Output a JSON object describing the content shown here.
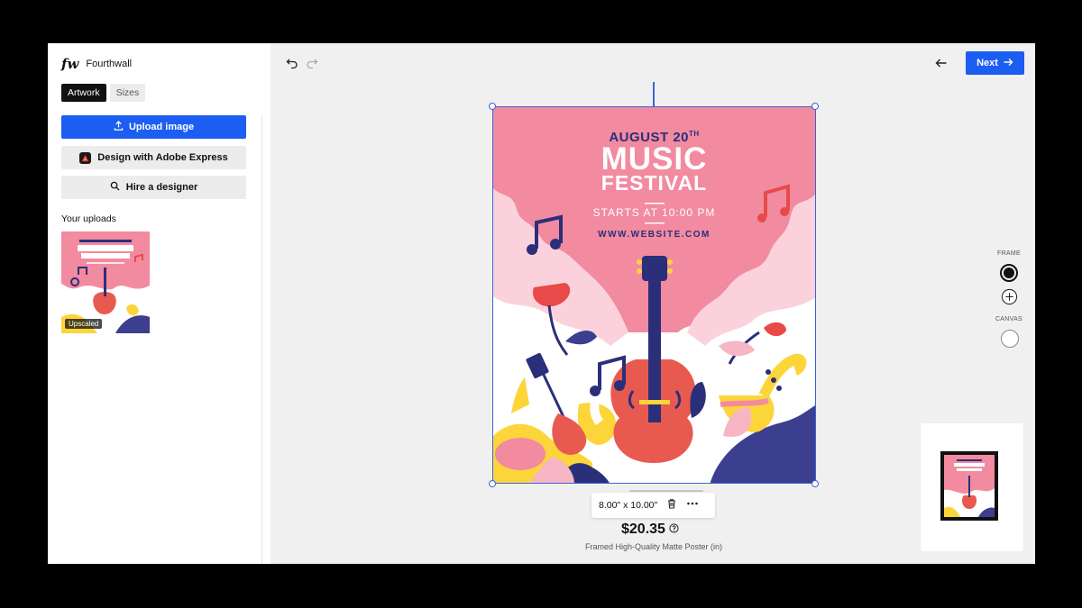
{
  "brand": {
    "logo": "fw",
    "name": "Fourthwall"
  },
  "tabs": [
    {
      "label": "Artwork",
      "active": true
    },
    {
      "label": "Sizes",
      "active": false
    }
  ],
  "actions": {
    "upload_image": "Upload image",
    "adobe_express": "Design with Adobe Express",
    "hire_designer": "Hire a designer"
  },
  "uploads": {
    "title": "Your uploads",
    "items": [
      {
        "badge": "Upscaled"
      }
    ]
  },
  "toolbar": {
    "next_label": "Next"
  },
  "poster": {
    "date": "AUGUST 20",
    "date_suffix": "TH",
    "title_line1": "MUSIC",
    "title_line2": "FESTIVAL",
    "time": "STARTS AT 10:00 PM",
    "website": "WWW.WEBSITE.COM"
  },
  "product": {
    "size": "8.00\" x 10.00\"",
    "price": "$20.35",
    "description": "Framed High-Quality Matte Poster (in)"
  },
  "options": {
    "frame_label": "FRAME",
    "canvas_label": "CANVAS",
    "frame_color": "#111111",
    "canvas_color": "#ffffff"
  },
  "colors": {
    "accent": "#1c5ef2",
    "poster_bg": "#f28aa0",
    "poster_title": "#ffffff",
    "poster_date": "#2b2f7a"
  }
}
